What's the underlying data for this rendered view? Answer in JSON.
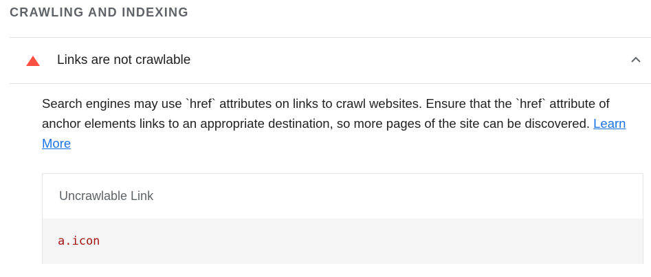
{
  "section": {
    "title": "CRAWLING AND INDEXING"
  },
  "audit": {
    "status_icon": "fail-triangle-icon",
    "status_color": "#ff4e42",
    "title": "Links are not crawlable",
    "expanded": true,
    "description_text": "Search engines may use `href` attributes on links to crawl websites. Ensure that the `href` attribute of anchor elements links to an appropriate destination, so more pages of the site can be discovered.",
    "learn_more_label": "Learn More",
    "link_color": "#1a73e8"
  },
  "table": {
    "column_header": "Uncrawlable Link",
    "rows": [
      {
        "node": "a.icon"
      }
    ]
  }
}
